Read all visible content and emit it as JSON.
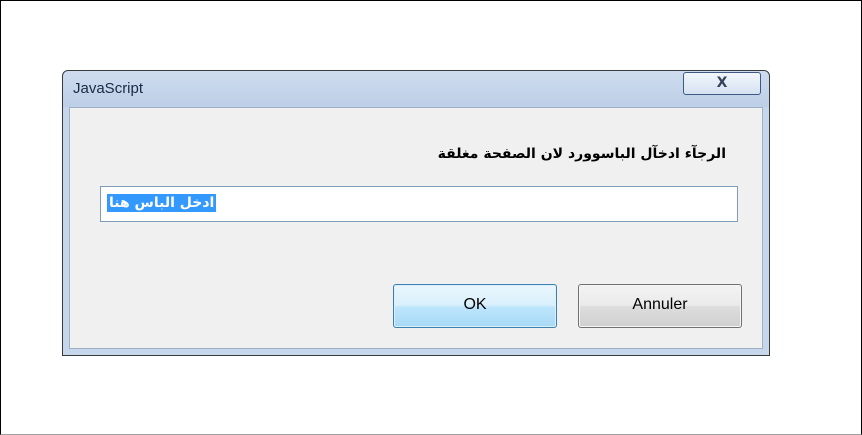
{
  "dialog": {
    "title": "JavaScript",
    "close_glyph": "X",
    "message": "الرجآء ادخآل الباسوورد لان الصفحة مغلقة",
    "input_value": "ادخل الباس هنا",
    "ok_label": "OK",
    "cancel_label": "Annuler"
  },
  "icons": {
    "close": "close-icon"
  },
  "colors": {
    "title_bar": "#c6d7ec",
    "selection": "#3399ff",
    "ok_button": "#bee6fd"
  }
}
